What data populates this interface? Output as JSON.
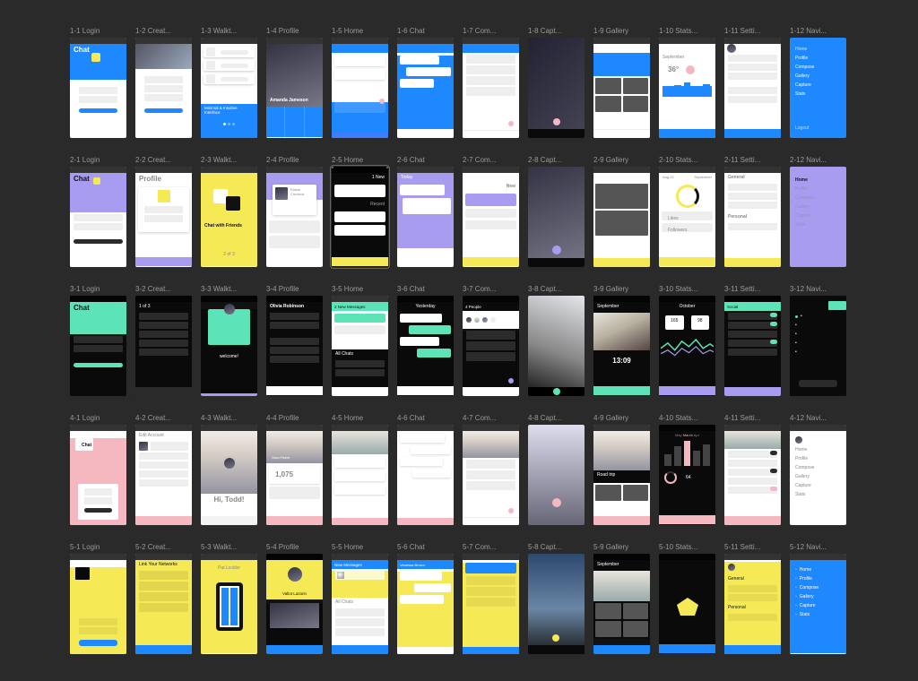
{
  "truncated_suffix": "...",
  "columns": [
    {
      "n": 1,
      "name": "Login"
    },
    {
      "n": 2,
      "name": "Creat"
    },
    {
      "n": 3,
      "name": "Walkt"
    },
    {
      "n": 4,
      "name": "Profile"
    },
    {
      "n": 5,
      "name": "Home"
    },
    {
      "n": 6,
      "name": "Chat"
    },
    {
      "n": 7,
      "name": "Com"
    },
    {
      "n": 8,
      "name": "Capt"
    },
    {
      "n": 9,
      "name": "Gallery"
    },
    {
      "n": 10,
      "name": "Stats"
    },
    {
      "n": 11,
      "name": "Setti"
    },
    {
      "n": 12,
      "name": "Navi"
    }
  ],
  "rows": 5,
  "selected_artboard": "2-5",
  "content": {
    "chat_title": "Chat",
    "profile_title": "Profile",
    "welcome_blue": "Minimal & Intuitive Interface",
    "chat_friends": "Chat with Friends",
    "stats_month_sep": "September",
    "stats_month_oct": "October",
    "stats_temp": "36",
    "stats_val_165": "165",
    "stats_val_98": "98",
    "stats_val_1309": "13:09",
    "stats_val_64": "64",
    "stats_val_1075": "1,075",
    "nav_home": "Home",
    "nav_profile": "Profile",
    "nav_compose": "Compose",
    "nav_gallery": "Gallery",
    "nav_capture": "Capture",
    "nav_stats": "Stats",
    "nav_logout": "Logout",
    "settings_general": "General",
    "settings_personal": "Personal",
    "settings_social": "Social",
    "home_new": "1 New",
    "home_recent": "Recent",
    "home_today": "Today",
    "home_new_msgs": "New Messages",
    "home_2new": "2 New Messages",
    "home_yesterday": "Yesterday",
    "home_all_chats": "All Chats",
    "home_four_people": "4 People",
    "greet_hi": "Hi, Todd!",
    "walkt_1of3": "1 of 3",
    "walkt_2of3": "2 of 3",
    "walkt_welcome": "welcome!",
    "profile_amanda": "Amanda Jameson",
    "profile_olivia": "Olivia Robinson",
    "profile_elaine": "Elaine Cordova",
    "profile_sara": "Sara Fisher",
    "profile_vallot": "Vallot Lazarin",
    "profile_pat": "Pat Lockler",
    "profile_link": "Link Your Networks",
    "profile_edit": "Edit Account",
    "aug_22": "Aug 22",
    "may_label": "May",
    "march_label": "March",
    "gallery_roadtrip": "Road trip",
    "comments_new": "New",
    "followers_label": "Followers",
    "likes_label": "Likes",
    "venessa_brown": "Venessa Brown"
  }
}
